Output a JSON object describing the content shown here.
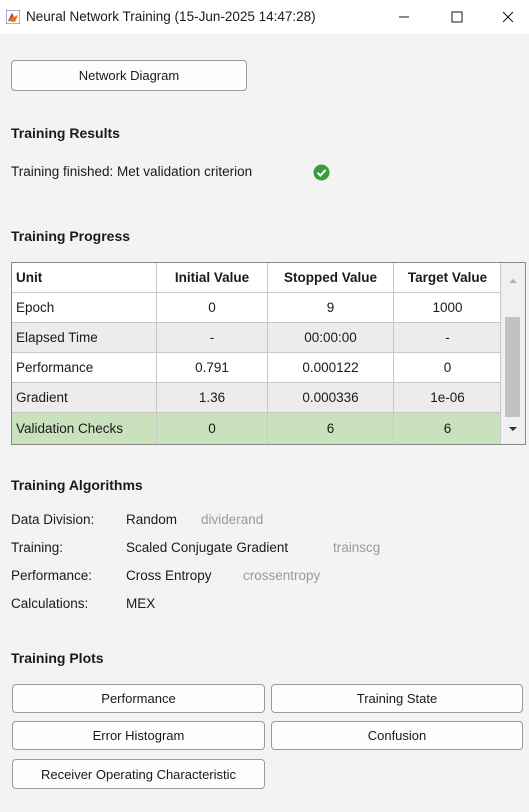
{
  "window": {
    "title": "Neural Network Training (15-Jun-2025 14:47:28)"
  },
  "buttons": {
    "network_diagram": "Network Diagram"
  },
  "results": {
    "heading": "Training Results",
    "status": "Training finished: Met validation criterion"
  },
  "progress": {
    "heading": "Training Progress",
    "columns": [
      "Unit",
      "Initial Value",
      "Stopped Value",
      "Target Value"
    ],
    "rows": [
      {
        "unit": "Epoch",
        "initial": "0",
        "stopped": "9",
        "target": "1000"
      },
      {
        "unit": "Elapsed Time",
        "initial": "-",
        "stopped": "00:00:00",
        "target": "-"
      },
      {
        "unit": "Performance",
        "initial": "0.791",
        "stopped": "0.000122",
        "target": "0"
      },
      {
        "unit": "Gradient",
        "initial": "1.36",
        "stopped": "0.000336",
        "target": "1e-06"
      },
      {
        "unit": "Validation Checks",
        "initial": "0",
        "stopped": "6",
        "target": "6"
      }
    ]
  },
  "algorithms": {
    "heading": "Training Algorithms",
    "items": [
      {
        "label": "Data Division:",
        "value": "Random",
        "func": "dividerand"
      },
      {
        "label": "Training:",
        "value": "Scaled Conjugate Gradient",
        "func": "trainscg"
      },
      {
        "label": "Performance:",
        "value": "Cross Entropy",
        "func": "crossentropy"
      },
      {
        "label": "Calculations:",
        "value": "MEX",
        "func": ""
      }
    ]
  },
  "plots": {
    "heading": "Training Plots",
    "buttons": [
      "Performance",
      "Training State",
      "Error Histogram",
      "Confusion",
      "Receiver Operating Characteristic"
    ]
  },
  "colors": {
    "success": "#3a9c3a",
    "highlight_row": "#c9e2bd"
  }
}
